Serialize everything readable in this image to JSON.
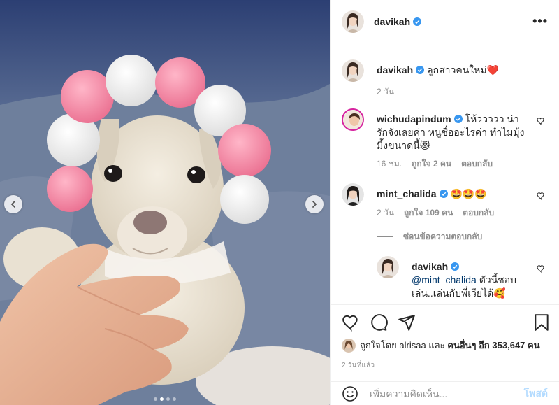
{
  "post": {
    "author": "davikah",
    "more_label": "•••"
  },
  "photo": {
    "nav_prev_icon": "chevron-left-icon",
    "nav_next_icon": "chevron-right-icon",
    "dot_count": 4,
    "active_dot": 1
  },
  "comments": {
    "caption": {
      "user": "davikah",
      "text": "ลูกสาวคนใหม่❤️",
      "time": "2 วัน"
    },
    "c1": {
      "user": "wichudapindum",
      "text": "โห้ววววว น่ารักจังเลยค่า หนูชื่ออะไรค่า ทำไมมุ้งมิ้งขนาดนี้😻",
      "time": "16 ชม.",
      "likes": "ถูกใจ 2 คน",
      "reply": "ตอบกลับ"
    },
    "c2": {
      "user": "mint_chalida",
      "text": "🤩🤩🤩",
      "time": "2 วัน",
      "likes": "ถูกใจ 109 คน",
      "reply": "ตอบกลับ",
      "hide_replies": "ซ่อนข้อความตอบกลับ"
    },
    "c3": {
      "user": "davikah",
      "mention": "@mint_chalida",
      "text": " ตัวนี้ชอบเล่น..เล่นกับพี่เวียได้🥰"
    }
  },
  "actions": {
    "like_icon": "heart-icon",
    "comment_icon": "comment-icon",
    "share_icon": "share-icon",
    "save_icon": "bookmark-icon"
  },
  "likes": {
    "prefix": "ถูกใจโดย",
    "user": "alrisaa",
    "and": "และ",
    "others": "คนอื่นๆ อีก 353,647 คน"
  },
  "timestamp": "2 วันที่แล้ว",
  "composer": {
    "placeholder": "เพิ่มความคิดเห็น...",
    "post_label": "โพสต์"
  },
  "colors": {
    "verified": "#3897f0",
    "muted": "#8e8e8e",
    "post_disabled": "#b3dbff"
  }
}
